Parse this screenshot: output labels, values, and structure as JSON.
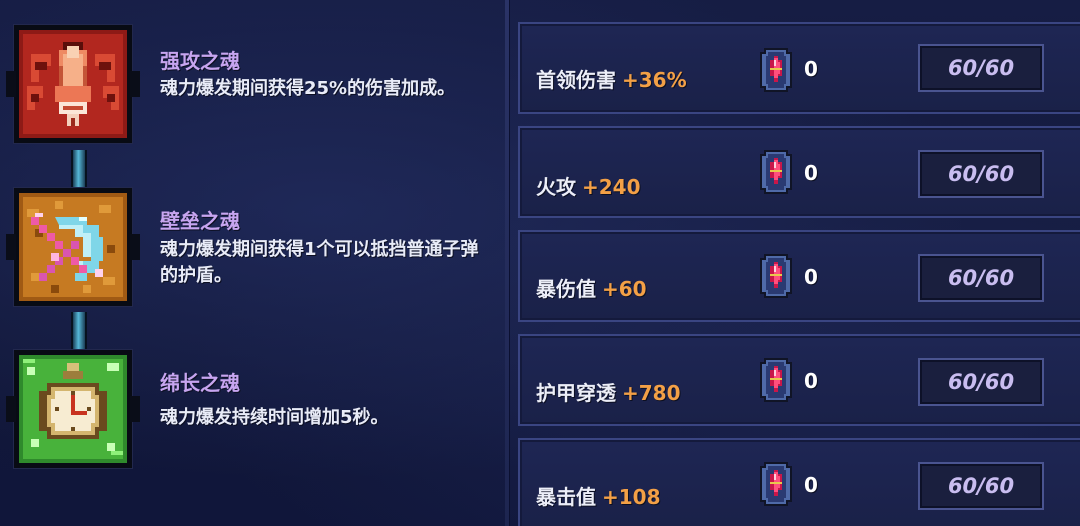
{
  "souls": [
    {
      "name": "强攻之魂",
      "desc": "魂力爆发期间获得25%的伤害加成。",
      "icon": "red-fist-icon"
    },
    {
      "name": "壁垒之魂",
      "desc": "魂力爆发期间获得1个可以抵挡普通子弹的护盾。",
      "icon": "shield-bow-icon"
    },
    {
      "name": "绵长之魂",
      "desc": "魂力爆发持续时间增加5秒。",
      "icon": "pocket-watch-icon"
    }
  ],
  "stats": [
    {
      "label": "首领伤害",
      "bonus": "+36%",
      "gem_count": "0",
      "level": "60/60"
    },
    {
      "label": "火攻",
      "bonus": "+240",
      "gem_count": "0",
      "level": "60/60"
    },
    {
      "label": "暴伤值",
      "bonus": "+60",
      "gem_count": "0",
      "level": "60/60"
    },
    {
      "label": "护甲穿透",
      "bonus": "+780",
      "gem_count": "0",
      "level": "60/60"
    },
    {
      "label": "暴击值",
      "bonus": "+108",
      "gem_count": "0",
      "level": "60/60"
    }
  ],
  "colors": {
    "soul_name": "#c7a5f0",
    "bonus": "#f3a046",
    "level_text": "#c9bdf0"
  }
}
